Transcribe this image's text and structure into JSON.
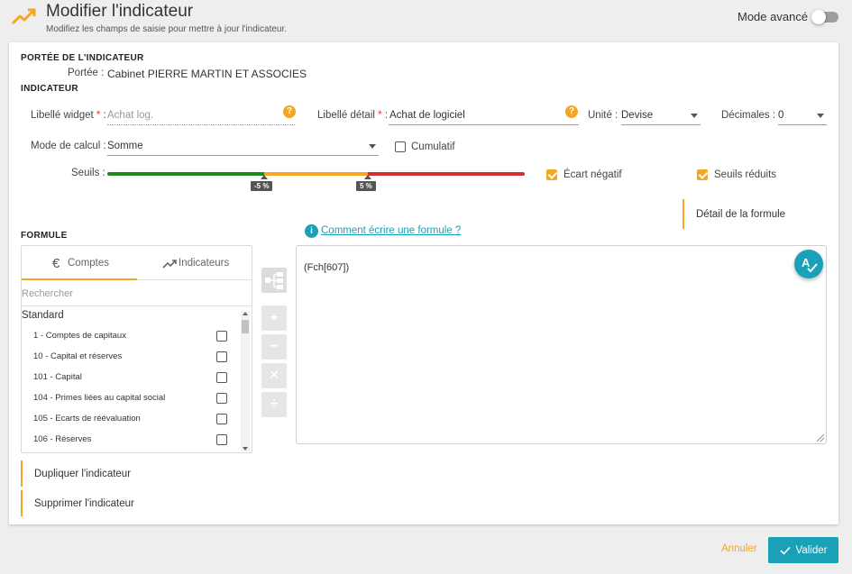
{
  "header": {
    "title": "Modifier l'indicateur",
    "subtitle": "Modifiez les champs de saisie pour mettre à jour l'indicateur.",
    "mode_label": "Mode avancé",
    "mode_enabled": false
  },
  "scope": {
    "section_title": "Portée de l'indicateur",
    "label": "Portée :",
    "value": "Cabinet PIERRE MARTIN ET ASSOCIES"
  },
  "indicator": {
    "section_title": "Indicateur",
    "widget_label": {
      "label": "Libellé widget",
      "required_mark": "*",
      "sep": ":",
      "placeholder": "Achat log."
    },
    "detail_label": {
      "label": "Libellé détail",
      "required_mark": "*",
      "sep": ":",
      "value": "Achat de logiciel"
    },
    "unit": {
      "label": "Unité :",
      "value": "Devise"
    },
    "decimals": {
      "label": "Décimales :",
      "value": "0"
    },
    "calc_mode": {
      "label": "Mode de calcul :",
      "value": "Somme"
    },
    "cumulative": {
      "label": "Cumulatif",
      "checked": false
    },
    "thresholds": {
      "label": "Seuils :",
      "low_value": "-5 %",
      "high_value": "5 %",
      "low_pct": -5,
      "high_pct": 5,
      "colors": {
        "good": "#1e8a1e",
        "mid": "#f5a623",
        "bad": "#d32f2f"
      }
    },
    "negative_gap": {
      "label": "Écart négatif",
      "checked": true
    },
    "reduced_thresholds": {
      "label": "Seuils réduits",
      "checked": true
    },
    "formula_detail_label": "Détail de la formule"
  },
  "formula": {
    "section_title": "Formule",
    "help_link": "Comment écrire une formule ?",
    "tabs": [
      {
        "label": "Comptes",
        "icon": "euro-icon",
        "active": true
      },
      {
        "label": "Indicateurs",
        "icon": "trend-icon",
        "active": false
      }
    ],
    "search_placeholder": "Rechercher",
    "group_label": "Standard",
    "accounts": [
      {
        "label": "1 - Comptes de capitaux",
        "checked": false
      },
      {
        "label": "10 - Capital et réserves",
        "checked": false
      },
      {
        "label": "101 - Capital",
        "checked": false
      },
      {
        "label": "104 - Primes liées au capital social",
        "checked": false
      },
      {
        "label": "105 - Ecarts de réévaluation",
        "checked": false
      },
      {
        "label": "106 - Réserves",
        "checked": false
      }
    ],
    "operators": [
      "+",
      "−",
      "×",
      "÷"
    ],
    "expression": "(Fch[607])"
  },
  "actions": {
    "duplicate": "Dupliquer l'indicateur",
    "delete": "Supprimer l'indicateur"
  },
  "footer": {
    "cancel": "Annuler",
    "submit": "Valider"
  },
  "colors": {
    "accent": "#f5a623",
    "primary": "#1aa1b8"
  }
}
